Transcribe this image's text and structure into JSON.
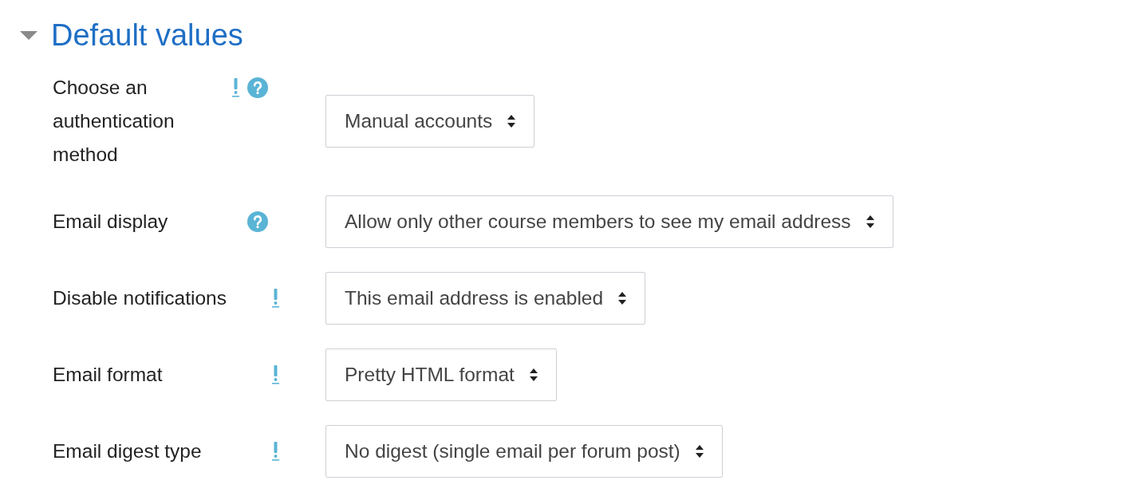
{
  "section": {
    "title": "Default values",
    "expanded": true
  },
  "fields": [
    {
      "label": "Choose an authentication method",
      "advanced": true,
      "help": true,
      "value": "Manual accounts"
    },
    {
      "label": "Email display",
      "advanced": false,
      "help": true,
      "value": "Allow only other course members to see my email address"
    },
    {
      "label": "Disable notifications",
      "advanced": true,
      "help": false,
      "value": "This email address is enabled"
    },
    {
      "label": "Email format",
      "advanced": true,
      "help": false,
      "value": "Pretty HTML format"
    },
    {
      "label": "Email digest type",
      "advanced": true,
      "help": false,
      "value": "No digest (single email per forum post)"
    }
  ]
}
